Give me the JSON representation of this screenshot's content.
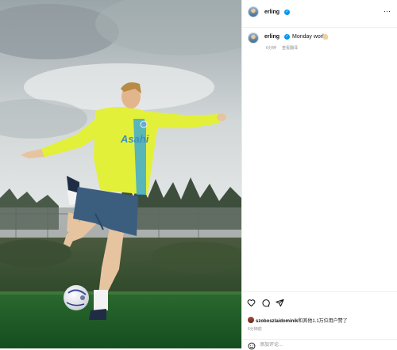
{
  "post": {
    "username": "erling",
    "caption_text": "Monday work",
    "caption_emoji": "flexed-biceps-emoji",
    "time_ago": "6分钟",
    "translate_label": "查看翻译",
    "likes_user": "szoboszlaidominik",
    "likes_suffix": "和其他1.1万位用户赞了",
    "timestamp": "6分钟前"
  },
  "comment": {
    "placeholder": "添加评论..."
  },
  "icons": {
    "more": "more-options-icon",
    "verified": "verified-badge-icon",
    "like": "heart-icon",
    "comment": "comment-icon",
    "share": "share-icon",
    "emoji": "emoji-icon"
  },
  "colors": {
    "verified_blue": "#0095f6",
    "jersey_yellow": "#e3f03a",
    "shorts_navy": "#3b5d7e",
    "pitch_green": "#1f6a2a"
  }
}
